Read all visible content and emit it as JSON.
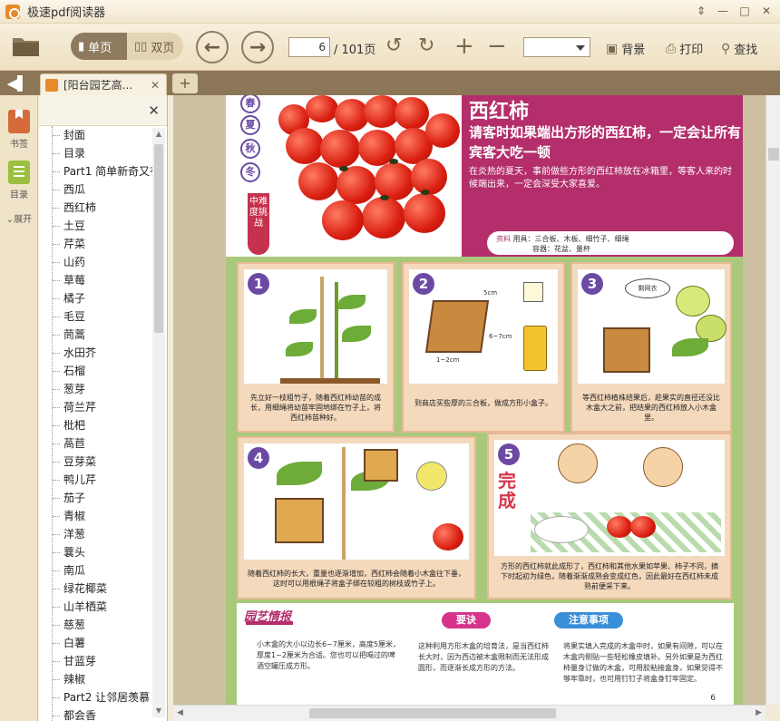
{
  "window": {
    "title": "极速pdf阅读器",
    "controls": [
      "⇕",
      "—",
      "□",
      "✕"
    ]
  },
  "toolbar": {
    "single_page": "单页",
    "double_page": "双页",
    "current_page": "6",
    "total_pages": "/ 101页",
    "background": "背景",
    "print": "打印",
    "search": "查找"
  },
  "tab": {
    "title": "[阳台园艺高..."
  },
  "rail": {
    "bookmarks": "书签",
    "toc": "目录",
    "expand": "展开"
  },
  "toc": {
    "items": [
      "封面",
      "目录",
      "Part1 简单新奇又有",
      "西瓜",
      "西红柿",
      "土豆",
      "芹菜",
      "山药",
      "草莓",
      "橘子",
      "毛豆",
      "茼蒿",
      "水田芥",
      "石榴",
      "葱芽",
      "荷兰芹",
      "枇杷",
      "萵苣",
      "豆芽菜",
      "鸭儿芹",
      "茄子",
      "青椒",
      "洋葱",
      "蘘头",
      "南瓜",
      "绿花椰菜",
      "山羊栖菜",
      "慈葱",
      "白薯",
      "甘蓝芽",
      "辣椒",
      "Part2 让邻居羡慕",
      "都会香"
    ]
  },
  "page": {
    "heading": "西红柿",
    "subheading": "请客时如果端出方形的西红柿，一定会让所有宾客大吃一顿",
    "description": "在炎热的夏天，事前做些方形的西红柿放在冰箱里，等客人来的时候端出来，一定会深受大家喜爱。",
    "materials_label": "资料",
    "materials": "用具：三合板、木板、细竹子、细绳",
    "container": "容器：花盆、量杯",
    "seasons": [
      "春",
      "夏",
      "秋",
      "冬"
    ],
    "difficulty": "中难度挑战",
    "steps": [
      {
        "num": "1",
        "caption": "先立好一枝粗竹子，随着西红柿幼苗的成长，用细绳将幼苗牢固地绑在竹子上，将西红柿苗种好。"
      },
      {
        "num": "2",
        "caption": "到商店买些厚的三合板，做成方形小盒子。"
      },
      {
        "num": "3",
        "caption": "等西红柿植株结果后，趁果实的直径还没比木盒大之前，把结果的西红柿放入小木盒里。"
      },
      {
        "num": "4",
        "caption": "随着西红柿的长大，重量也逐渐增加，西红柿会随着小木盒往下垂，这时可以用根绳子将盒子绑在较粗的树枝或竹子上。"
      },
      {
        "num": "5",
        "caption": "方形的西红柿就此成形了，西红柿和其他水果如苹果、柿子不同，摘下时起初为绿色，随着渐渐成熟会变成红色，因此最好在西红柿未成熟前便采下来。"
      }
    ],
    "step2_labels": {
      "top": "5cm",
      "side": "1~2cm",
      "mid": "6~7cm"
    },
    "step3_label": "剩网衣",
    "complete_label": "完成",
    "info_title": "园艺情报",
    "info_text": "小木盒的大小以边长6~7厘米，高度5厘米，厚度1~2厘米为合适。您也可以把喝过的啤酒空罐压成方形。",
    "tips_chip": "要诀",
    "tips_text": "这种利用方形木盒的培育法，是当西红柿长大时，因为西边被木盒限制而无法形成圆形，而逐渐长成方形的方法。",
    "notes_chip": "注意事项",
    "notes_text": "将果实填入完成的木盒中时，如果有间隙，可以在木盒内侧贴一些轻松橡皮填补。另外如果是为西红柿量身订做的木盒，可用胶粘接盒身，如果觉得不够牢靠时，也可用钉钉子将盒身钉牢固定。",
    "page_number": "6"
  },
  "colors": {
    "accent": "#b32e6a",
    "toolbar": "#eee0c1",
    "tabstrip": "#8b7657",
    "page_bg": "#a9c87b"
  }
}
